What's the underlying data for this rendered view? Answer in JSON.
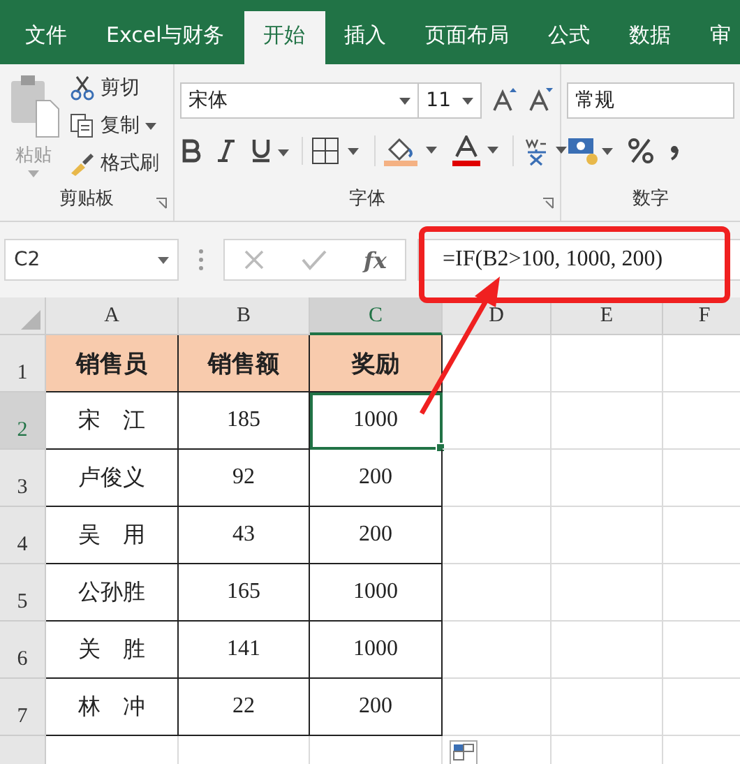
{
  "tabs": [
    {
      "label": "文件",
      "selected": false
    },
    {
      "label": "Excel与财务",
      "selected": false
    },
    {
      "label": "开始",
      "selected": true
    },
    {
      "label": "插入",
      "selected": false
    },
    {
      "label": "页面布局",
      "selected": false
    },
    {
      "label": "公式",
      "selected": false
    },
    {
      "label": "数据",
      "selected": false
    },
    {
      "label": "审",
      "selected": false
    }
  ],
  "clipboard": {
    "paste": {
      "label": "粘贴",
      "disabled": true
    },
    "items": [
      {
        "label": "剪切",
        "kind": "cut"
      },
      {
        "label": "复制",
        "kind": "copy"
      },
      {
        "label": "格式刷",
        "kind": "painter"
      }
    ],
    "group_label": "剪贴板"
  },
  "font": {
    "font_name": "宋体",
    "font_size": "11",
    "group_label": "字体"
  },
  "number": {
    "format": "常规",
    "group_label": "数字"
  },
  "formula_bar": {
    "name_box": "C2",
    "fx": "fx",
    "formula": "=IF(B2>100, 1000, 200)"
  },
  "columns": [
    {
      "label": "A",
      "selected": false
    },
    {
      "label": "B",
      "selected": false
    },
    {
      "label": "C",
      "selected": true
    },
    {
      "label": "D",
      "selected": false
    },
    {
      "label": "E",
      "selected": false
    },
    {
      "label": "F",
      "selected": false
    }
  ],
  "rows": [
    {
      "label": "1",
      "kind": "header",
      "selected": false,
      "cells": [
        {
          "text": "销售员",
          "selected": false
        },
        {
          "text": "销售额",
          "selected": false
        },
        {
          "text": "奖励",
          "selected": false
        }
      ]
    },
    {
      "label": "2",
      "kind": "data",
      "selected": true,
      "cells": [
        {
          "text": "宋　江",
          "selected": false
        },
        {
          "text": "185",
          "selected": false
        },
        {
          "text": "1000",
          "selected": true
        }
      ]
    },
    {
      "label": "3",
      "kind": "data",
      "selected": false,
      "cells": [
        {
          "text": "卢俊义",
          "selected": false
        },
        {
          "text": "92",
          "selected": false
        },
        {
          "text": "200",
          "selected": false
        }
      ]
    },
    {
      "label": "4",
      "kind": "data",
      "selected": false,
      "cells": [
        {
          "text": "吴　用",
          "selected": false
        },
        {
          "text": "43",
          "selected": false
        },
        {
          "text": "200",
          "selected": false
        }
      ]
    },
    {
      "label": "5",
      "kind": "data",
      "selected": false,
      "cells": [
        {
          "text": "公孙胜",
          "selected": false
        },
        {
          "text": "165",
          "selected": false
        },
        {
          "text": "1000",
          "selected": false
        }
      ]
    },
    {
      "label": "6",
      "kind": "data",
      "selected": false,
      "cells": [
        {
          "text": "关　胜",
          "selected": false
        },
        {
          "text": "141",
          "selected": false
        },
        {
          "text": "1000",
          "selected": false
        }
      ]
    },
    {
      "label": "7",
      "kind": "data",
      "selected": false,
      "cells": [
        {
          "text": "林　冲",
          "selected": false
        },
        {
          "text": "22",
          "selected": false
        },
        {
          "text": "200",
          "selected": false
        }
      ]
    }
  ]
}
